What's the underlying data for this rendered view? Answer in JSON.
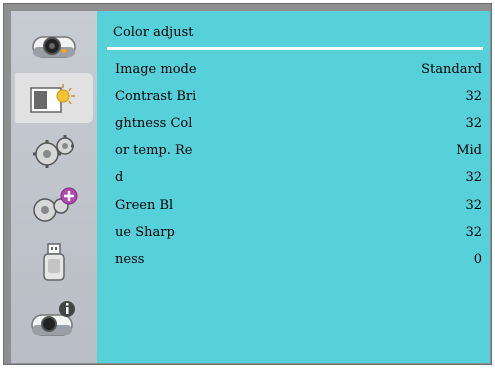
{
  "panel": {
    "title": "Color adjust",
    "rows": [
      {
        "label": "Image mode",
        "value": "Standard"
      },
      {
        "label": "Contrast  Bri",
        "value": "32"
      },
      {
        "label": "ghtness  Col",
        "value": "32"
      },
      {
        "label": "or temp.  Re",
        "value": "Mid"
      },
      {
        "label": "d",
        "value": "32"
      },
      {
        "label": "Green   Bl",
        "value": "32"
      },
      {
        "label": "ue  Sharp",
        "value": "32"
      },
      {
        "label": "ness",
        "value": "0"
      }
    ]
  },
  "sidebar": {
    "icons": [
      "projector-icon",
      "image-adjust-icon",
      "settings-gears-icon",
      "extended-settings-icon",
      "usb-icon",
      "info-projector-icon"
    ]
  },
  "colors": {
    "panel_bg": "#56d1d9",
    "sidebar_bg": "#c0c4cb",
    "selected_bg": "#e1e1e1",
    "frame": "#8f8f8f"
  }
}
